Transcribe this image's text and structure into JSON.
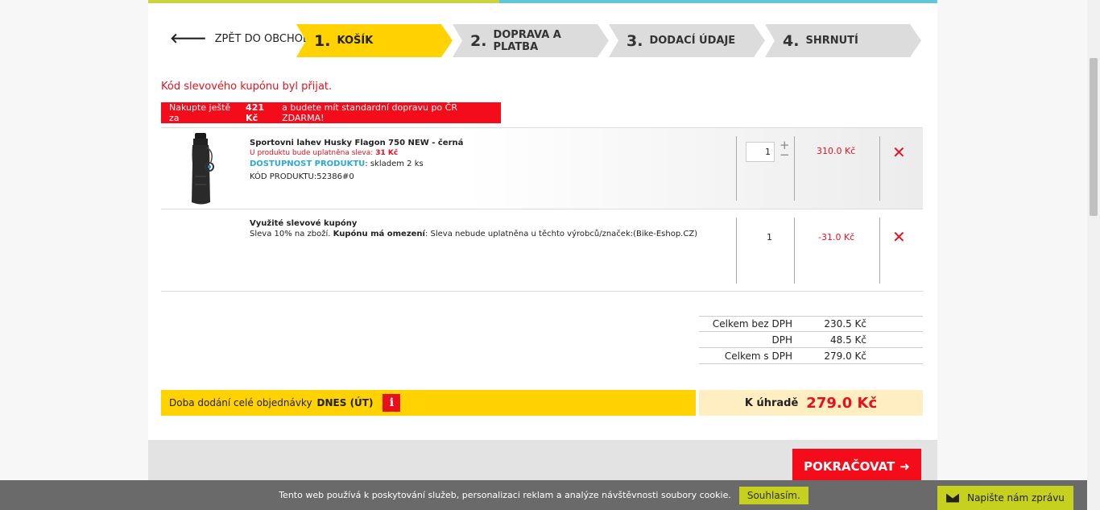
{
  "nav": {
    "back_label": "ZPĚT DO OBCHODU",
    "steps": [
      {
        "num": "1.",
        "label": "KOŠÍK"
      },
      {
        "num": "2.",
        "label": "DOPRAVA A PLATBA"
      },
      {
        "num": "3.",
        "label": "DODACÍ ÚDAJE"
      },
      {
        "num": "4.",
        "label": "SHRNUTÍ"
      }
    ]
  },
  "messages": {
    "coupon_accepted": "Kód slevového kupónu byl přijat.",
    "free_ship_pre": "Nakupte ještě za",
    "free_ship_amount": "421 Kč",
    "free_ship_post": "a budete mít standardní dopravu po ČR ZDARMA!"
  },
  "cart": {
    "product": {
      "name": "Sportovni lahev Husky Flagon 750 NEW - černá",
      "discount_text": "U produktu bude uplatněna sleva:",
      "discount_value": "31 Kč",
      "availability_label": "DOSTUPNOST PRODUKTU",
      "availability_value": ": skladem 2 ks",
      "code": "KÓD PRODUKTU:52386#0",
      "quantity": "1",
      "price": "310.0 Kč"
    },
    "coupon": {
      "title": "Využité slevové kupóny",
      "desc_pre": "Sleva 10% na zboží.",
      "desc_bold": "Kupónu má omezení",
      "desc_post": ": Sleva nebude uplatněna u těchto výrobců/značek:(Bike-Eshop.CZ)",
      "quantity": "1",
      "price": "-31.0 Kč"
    },
    "delete_symbol": "✕"
  },
  "summary": {
    "rows": [
      {
        "label": "Celkem bez DPH",
        "value": "230.5 Kč"
      },
      {
        "label": "DPH",
        "value": "48.5 Kč"
      },
      {
        "label": "Celkem s DPH",
        "value": "279.0 Kč"
      }
    ],
    "delivery_label": "Doba dodání celé objednávky",
    "delivery_value": "DNES (ÚT)",
    "info_symbol": "i",
    "to_pay_label": "K úhradě",
    "to_pay_value": "279.0 Kč",
    "continue_label": "POKRAČOVAT"
  },
  "cookie": {
    "text": "Tento web používá k poskytování služeb, personalizaci reklam a analýze návštěvnosti soubory cookie.",
    "accept_label": "Souhlasím."
  },
  "chat": {
    "label": "Napište nám zprávu"
  }
}
